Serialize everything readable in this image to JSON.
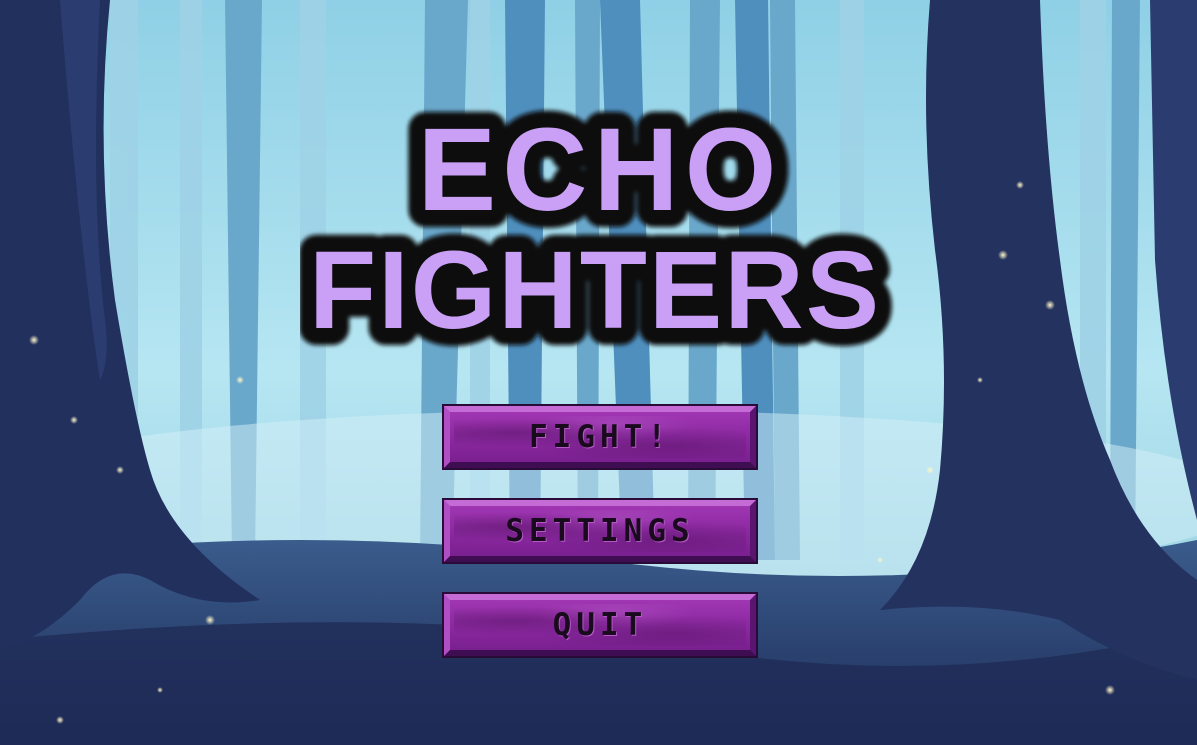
{
  "game": {
    "title_line1": "ECHO",
    "title_line2": "FIGHTERS"
  },
  "menu": {
    "fight_label": "FIGHT!",
    "settings_label": "SETTINGS",
    "quit_label": "QUIT"
  },
  "colors": {
    "logo_fill": "#c9a0f5",
    "logo_outline": "#0a0a0a",
    "button_fill": "#8e2aa3",
    "button_text": "#1a0a1e",
    "sky": "#a9e0ef",
    "trees": "#22305e"
  }
}
